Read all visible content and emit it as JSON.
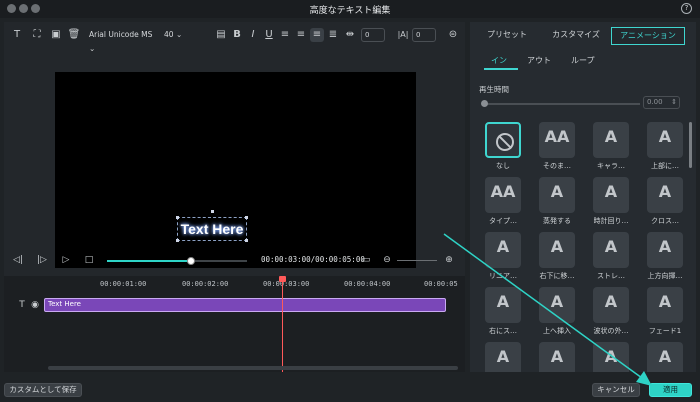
{
  "window": {
    "title": "高度なテキスト編集",
    "help_label": "?"
  },
  "toolbar": {
    "font_family": "Arial Unicode MS",
    "font_size": "40",
    "letter_spacing": "0",
    "line_spacing": "0"
  },
  "preview": {
    "text": "Text Here"
  },
  "playback": {
    "timecode": "00:00:03:00/00:00:05:00",
    "progress_fraction": 0.6
  },
  "timeline": {
    "ticks": [
      "00:00:01:00",
      "00:00:02:00",
      "00:00:03:00",
      "00:00:04:00",
      "00:00:05"
    ],
    "track_label": "Text Here"
  },
  "tabs": {
    "top": [
      "プリセット",
      "カスタマイズ",
      "アニメーション"
    ],
    "active_top": "アニメーション",
    "sub": [
      "イン",
      "アウト",
      "ループ"
    ],
    "active_sub": "イン"
  },
  "duration": {
    "label": "再生時間",
    "value": "0.00"
  },
  "animations": [
    {
      "label": "なし",
      "icon": "none-icon"
    },
    {
      "label": "そのま…",
      "icon": "anim-icon"
    },
    {
      "label": "キャラ…",
      "icon": "anim-icon"
    },
    {
      "label": "上部に…",
      "icon": "anim-icon"
    },
    {
      "label": "タイプ…",
      "icon": "anim-icon"
    },
    {
      "label": "蒸発する",
      "icon": "anim-icon"
    },
    {
      "label": "時計回り…",
      "icon": "anim-icon"
    },
    {
      "label": "クロス…",
      "icon": "anim-icon"
    },
    {
      "label": "リニア…",
      "icon": "anim-icon"
    },
    {
      "label": "右下に移…",
      "icon": "anim-icon"
    },
    {
      "label": "ストレ…",
      "icon": "anim-icon"
    },
    {
      "label": "上方向揮…",
      "icon": "anim-icon"
    },
    {
      "label": "右にス…",
      "icon": "anim-icon"
    },
    {
      "label": "上へ挿入",
      "icon": "anim-icon"
    },
    {
      "label": "波状の外…",
      "icon": "anim-icon"
    },
    {
      "label": "フェード1",
      "icon": "anim-icon"
    },
    {
      "label": "",
      "icon": "anim-icon"
    },
    {
      "label": "",
      "icon": "anim-icon"
    },
    {
      "label": "",
      "icon": "anim-icon"
    },
    {
      "label": "",
      "icon": "anim-icon"
    }
  ],
  "buttons": {
    "save_custom": "カスタムとして保存",
    "cancel": "キャンセル",
    "apply": "適用"
  },
  "colors": {
    "accent": "#2ed3c6",
    "track": "#7a47b8",
    "playhead": "#ff5a5a"
  }
}
